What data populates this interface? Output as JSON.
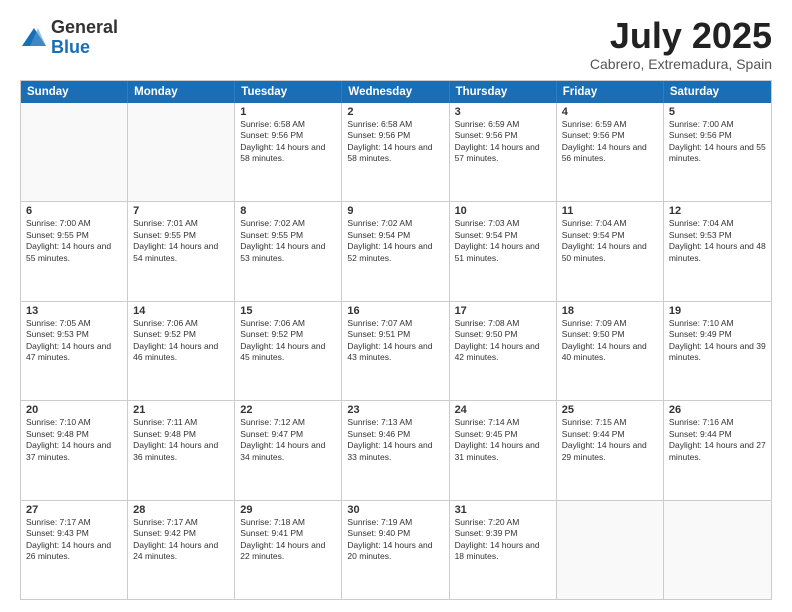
{
  "logo": {
    "general": "General",
    "blue": "Blue"
  },
  "title": "July 2025",
  "location": "Cabrero, Extremadura, Spain",
  "header_days": [
    "Sunday",
    "Monday",
    "Tuesday",
    "Wednesday",
    "Thursday",
    "Friday",
    "Saturday"
  ],
  "weeks": [
    [
      {
        "day": "",
        "info": ""
      },
      {
        "day": "",
        "info": ""
      },
      {
        "day": "1",
        "info": "Sunrise: 6:58 AM\nSunset: 9:56 PM\nDaylight: 14 hours and 58 minutes."
      },
      {
        "day": "2",
        "info": "Sunrise: 6:58 AM\nSunset: 9:56 PM\nDaylight: 14 hours and 58 minutes."
      },
      {
        "day": "3",
        "info": "Sunrise: 6:59 AM\nSunset: 9:56 PM\nDaylight: 14 hours and 57 minutes."
      },
      {
        "day": "4",
        "info": "Sunrise: 6:59 AM\nSunset: 9:56 PM\nDaylight: 14 hours and 56 minutes."
      },
      {
        "day": "5",
        "info": "Sunrise: 7:00 AM\nSunset: 9:56 PM\nDaylight: 14 hours and 55 minutes."
      }
    ],
    [
      {
        "day": "6",
        "info": "Sunrise: 7:00 AM\nSunset: 9:55 PM\nDaylight: 14 hours and 55 minutes."
      },
      {
        "day": "7",
        "info": "Sunrise: 7:01 AM\nSunset: 9:55 PM\nDaylight: 14 hours and 54 minutes."
      },
      {
        "day": "8",
        "info": "Sunrise: 7:02 AM\nSunset: 9:55 PM\nDaylight: 14 hours and 53 minutes."
      },
      {
        "day": "9",
        "info": "Sunrise: 7:02 AM\nSunset: 9:54 PM\nDaylight: 14 hours and 52 minutes."
      },
      {
        "day": "10",
        "info": "Sunrise: 7:03 AM\nSunset: 9:54 PM\nDaylight: 14 hours and 51 minutes."
      },
      {
        "day": "11",
        "info": "Sunrise: 7:04 AM\nSunset: 9:54 PM\nDaylight: 14 hours and 50 minutes."
      },
      {
        "day": "12",
        "info": "Sunrise: 7:04 AM\nSunset: 9:53 PM\nDaylight: 14 hours and 48 minutes."
      }
    ],
    [
      {
        "day": "13",
        "info": "Sunrise: 7:05 AM\nSunset: 9:53 PM\nDaylight: 14 hours and 47 minutes."
      },
      {
        "day": "14",
        "info": "Sunrise: 7:06 AM\nSunset: 9:52 PM\nDaylight: 14 hours and 46 minutes."
      },
      {
        "day": "15",
        "info": "Sunrise: 7:06 AM\nSunset: 9:52 PM\nDaylight: 14 hours and 45 minutes."
      },
      {
        "day": "16",
        "info": "Sunrise: 7:07 AM\nSunset: 9:51 PM\nDaylight: 14 hours and 43 minutes."
      },
      {
        "day": "17",
        "info": "Sunrise: 7:08 AM\nSunset: 9:50 PM\nDaylight: 14 hours and 42 minutes."
      },
      {
        "day": "18",
        "info": "Sunrise: 7:09 AM\nSunset: 9:50 PM\nDaylight: 14 hours and 40 minutes."
      },
      {
        "day": "19",
        "info": "Sunrise: 7:10 AM\nSunset: 9:49 PM\nDaylight: 14 hours and 39 minutes."
      }
    ],
    [
      {
        "day": "20",
        "info": "Sunrise: 7:10 AM\nSunset: 9:48 PM\nDaylight: 14 hours and 37 minutes."
      },
      {
        "day": "21",
        "info": "Sunrise: 7:11 AM\nSunset: 9:48 PM\nDaylight: 14 hours and 36 minutes."
      },
      {
        "day": "22",
        "info": "Sunrise: 7:12 AM\nSunset: 9:47 PM\nDaylight: 14 hours and 34 minutes."
      },
      {
        "day": "23",
        "info": "Sunrise: 7:13 AM\nSunset: 9:46 PM\nDaylight: 14 hours and 33 minutes."
      },
      {
        "day": "24",
        "info": "Sunrise: 7:14 AM\nSunset: 9:45 PM\nDaylight: 14 hours and 31 minutes."
      },
      {
        "day": "25",
        "info": "Sunrise: 7:15 AM\nSunset: 9:44 PM\nDaylight: 14 hours and 29 minutes."
      },
      {
        "day": "26",
        "info": "Sunrise: 7:16 AM\nSunset: 9:44 PM\nDaylight: 14 hours and 27 minutes."
      }
    ],
    [
      {
        "day": "27",
        "info": "Sunrise: 7:17 AM\nSunset: 9:43 PM\nDaylight: 14 hours and 26 minutes."
      },
      {
        "day": "28",
        "info": "Sunrise: 7:17 AM\nSunset: 9:42 PM\nDaylight: 14 hours and 24 minutes."
      },
      {
        "day": "29",
        "info": "Sunrise: 7:18 AM\nSunset: 9:41 PM\nDaylight: 14 hours and 22 minutes."
      },
      {
        "day": "30",
        "info": "Sunrise: 7:19 AM\nSunset: 9:40 PM\nDaylight: 14 hours and 20 minutes."
      },
      {
        "day": "31",
        "info": "Sunrise: 7:20 AM\nSunset: 9:39 PM\nDaylight: 14 hours and 18 minutes."
      },
      {
        "day": "",
        "info": ""
      },
      {
        "day": "",
        "info": ""
      }
    ]
  ]
}
